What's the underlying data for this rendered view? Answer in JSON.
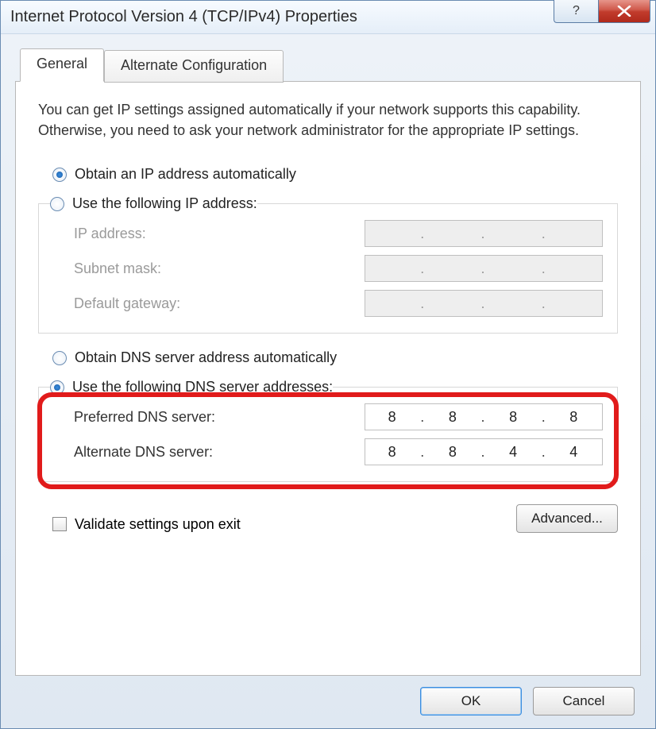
{
  "window": {
    "title": "Internet Protocol Version 4 (TCP/IPv4) Properties"
  },
  "tabs": {
    "general": "General",
    "alternate": "Alternate Configuration"
  },
  "intro": "You can get IP settings assigned automatically if your network supports this capability. Otherwise, you need to ask your network administrator for the appropriate IP settings.",
  "ip": {
    "auto_label": "Obtain an IP address automatically",
    "manual_label": "Use the following IP address:",
    "ip_label": "IP address:",
    "subnet_label": "Subnet mask:",
    "gateway_label": "Default gateway:",
    "ip_value": [
      "",
      "",
      "",
      ""
    ],
    "subnet_value": [
      "",
      "",
      "",
      ""
    ],
    "gateway_value": [
      "",
      "",
      "",
      ""
    ]
  },
  "dns": {
    "auto_label": "Obtain DNS server address automatically",
    "manual_label": "Use the following DNS server addresses:",
    "preferred_label": "Preferred DNS server:",
    "alternate_label": "Alternate DNS server:",
    "preferred_value": [
      "8",
      "8",
      "8",
      "8"
    ],
    "alternate_value": [
      "8",
      "8",
      "4",
      "4"
    ]
  },
  "validate_label": "Validate settings upon exit",
  "buttons": {
    "advanced": "Advanced...",
    "ok": "OK",
    "cancel": "Cancel"
  }
}
